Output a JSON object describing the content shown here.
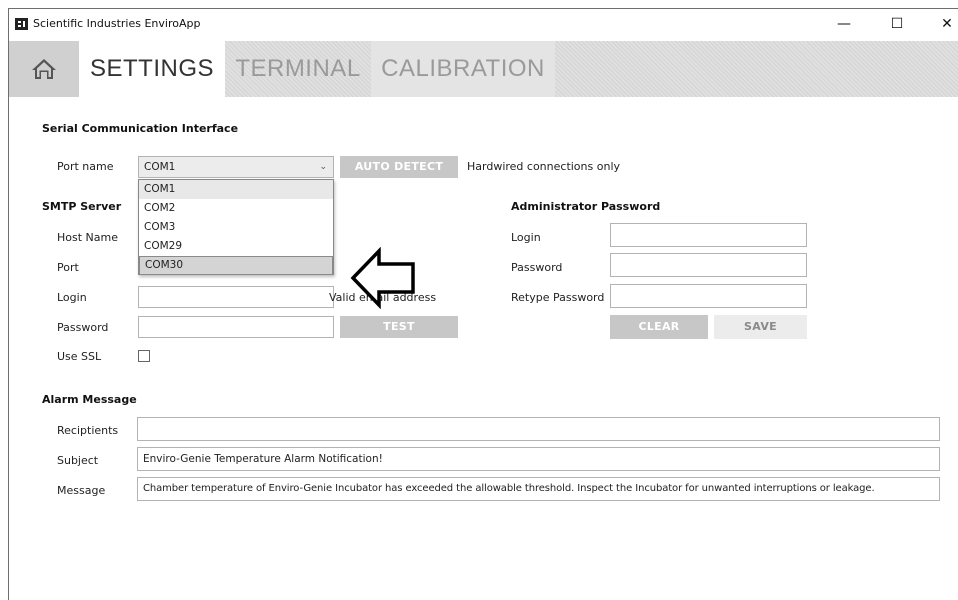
{
  "window": {
    "title": "Scientific Industries EnviroApp",
    "controls": {
      "minimize": "—",
      "maximize": "☐",
      "close": "✕"
    }
  },
  "tabs": {
    "home_icon": "home-icon",
    "items": [
      {
        "label": "SETTINGS",
        "active": true
      },
      {
        "label": "TERMINAL",
        "active": false
      },
      {
        "label": "CALIBRATION",
        "active": false
      }
    ]
  },
  "serial": {
    "section_title": "Serial Communication Interface",
    "port_label": "Port name",
    "port_value": "COM1",
    "auto_detect_label": "AUTO DETECT",
    "hardwired_note": "Hardwired connections only",
    "port_options": [
      "COM1",
      "COM2",
      "COM3",
      "COM29",
      "COM30"
    ],
    "port_highlighted": "COM30"
  },
  "smtp": {
    "section_title": "SMTP Server",
    "host_label": "Host Name",
    "port_label": "Port",
    "login_label": "Login",
    "password_label": "Password",
    "ssl_label": "Use SSL",
    "email_note": "Valid email address",
    "test_label": "TEST",
    "login_value": "",
    "password_value": "",
    "use_ssl": false
  },
  "admin": {
    "section_title": "Administrator Password",
    "login_label": "Login",
    "password_label": "Password",
    "retype_label": "Retype Password",
    "clear_label": "CLEAR",
    "save_label": "SAVE",
    "login_value": "",
    "password_value": "",
    "retype_value": ""
  },
  "alarm": {
    "section_title": "Alarm Message",
    "recipients_label": "Reciptients",
    "subject_label": "Subject",
    "message_label": "Message",
    "recipients_value": "",
    "subject_value": "Enviro-Genie Temperature Alarm Notification!",
    "message_value": "Chamber temperature of Enviro-Genie Incubator has exceeded the allowable threshold. Inspect the Incubator for unwanted interruptions or leakage."
  },
  "annotation": {
    "icon": "left-arrow-icon"
  }
}
